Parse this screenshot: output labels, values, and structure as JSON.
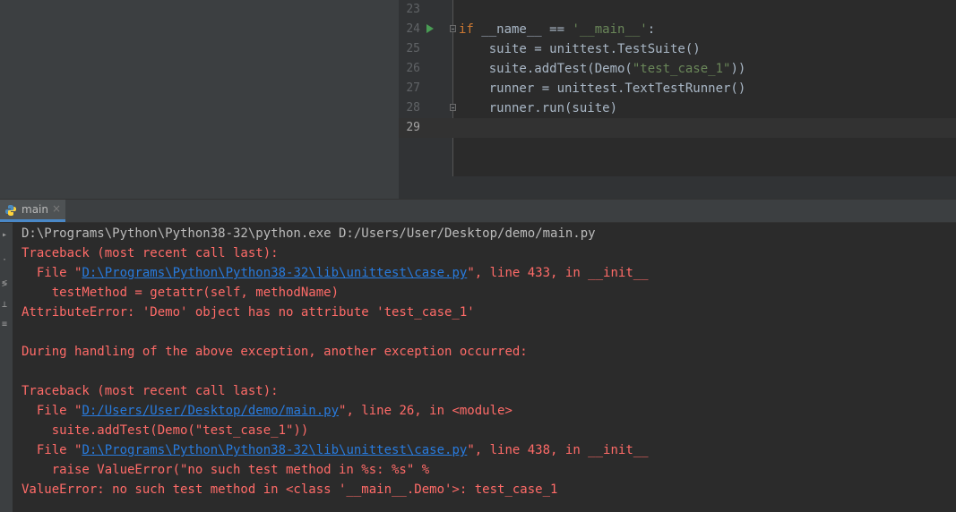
{
  "editor": {
    "lines": [
      {
        "num": "23"
      },
      {
        "num": "24",
        "kw": "if",
        "text": " __name__ == ",
        "str": "'__main__'",
        "tail": ":"
      },
      {
        "num": "25",
        "text": "    suite = unittest.TestSuite()"
      },
      {
        "num": "26",
        "pre": "    suite.addTest(Demo(",
        "str": "\"test_case_1\"",
        "tail": "))"
      },
      {
        "num": "27",
        "text": "    runner = unittest.TextTestRunner()"
      },
      {
        "num": "28",
        "text": "    runner.run(suite)"
      },
      {
        "num": "29"
      }
    ]
  },
  "run_tab": {
    "label": "main",
    "close": "×",
    "icon": "python-icon"
  },
  "console": {
    "command": "D:\\Programs\\Python\\Python38-32\\python.exe D:/Users/User/Desktop/demo/main.py",
    "tb1_header": "Traceback (most recent call last):",
    "tb1_file_pre": "  File \"",
    "tb1_file_link": "D:\\Programs\\Python\\Python38-32\\lib\\unittest\\case.py",
    "tb1_file_post": "\", line 433, in __init__",
    "tb1_code": "    testMethod = getattr(self, methodName)",
    "tb1_error": "AttributeError: 'Demo' object has no attribute 'test_case_1'",
    "during": "During handling of the above exception, another exception occurred:",
    "tb2_header": "Traceback (most recent call last):",
    "tb2_file1_pre": "  File \"",
    "tb2_file1_link": "D:/Users/User/Desktop/demo/main.py",
    "tb2_file1_post": "\", line 26, in <module>",
    "tb2_code1": "    suite.addTest(Demo(\"test_case_1\"))",
    "tb2_file2_pre": "  File \"",
    "tb2_file2_link": "D:\\Programs\\Python\\Python38-32\\lib\\unittest\\case.py",
    "tb2_file2_post": "\", line 438, in __init__",
    "tb2_code2": "    raise ValueError(\"no such test method in %s: %s\" %",
    "tb2_error": "ValueError: no such test method in <class '__main__.Demo'>: test_case_1"
  },
  "toolbar": {
    "icons": [
      "rerun-icon",
      "stop-icon",
      "soft-wrap-icon",
      "pin-icon",
      "print-icon"
    ]
  },
  "colors": {
    "error": "#ff6b68",
    "link": "#287bde",
    "keyword": "#cc7832",
    "string": "#6a8759",
    "run_gutter": "#499c54",
    "tab_underline": "#4a88c7"
  }
}
